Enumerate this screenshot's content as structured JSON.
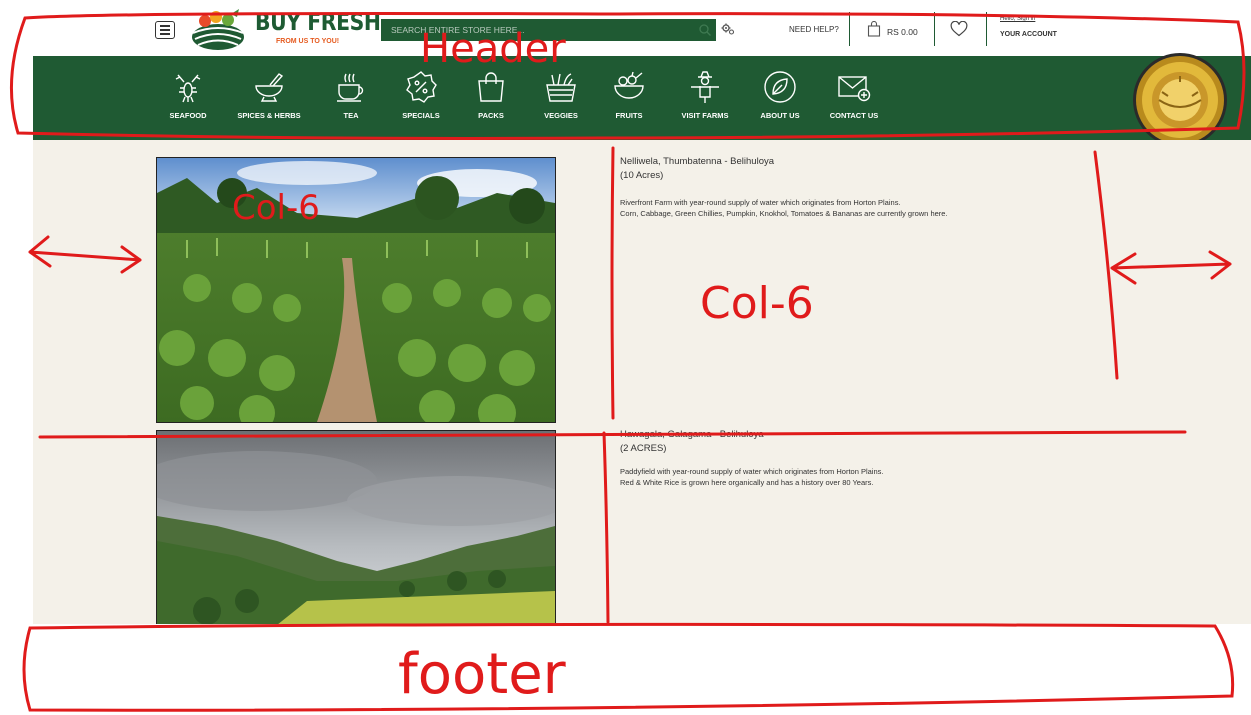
{
  "header": {
    "logo": {
      "brand": "BUY FRESH",
      "tagline": "FROM US TO YOU!"
    },
    "search": {
      "placeholder": "SEARCH ENTIRE STORE HERE..."
    },
    "help_label": "NEED HELP?",
    "cart": {
      "total": "RS 0.00"
    },
    "account": {
      "greeting": "Hello, Sign in",
      "label": "YOUR ACCOUNT"
    }
  },
  "nav": {
    "items": [
      {
        "label": "SEAFOOD",
        "icon": "lobster-icon"
      },
      {
        "label": "SPICES & HERBS",
        "icon": "mortar-pestle-icon"
      },
      {
        "label": "TEA",
        "icon": "tea-cup-icon"
      },
      {
        "label": "SPECIALS",
        "icon": "percent-badge-icon"
      },
      {
        "label": "PACKS",
        "icon": "shopping-bag-icon"
      },
      {
        "label": "VEGGIES",
        "icon": "vegetable-basket-icon"
      },
      {
        "label": "FRUITS",
        "icon": "fruit-bowl-icon"
      },
      {
        "label": "VISIT FARMS",
        "icon": "scarecrow-icon"
      },
      {
        "label": "ABOUT US",
        "icon": "leaf-circle-icon"
      },
      {
        "label": "CONTACT US",
        "icon": "envelope-plus-icon"
      }
    ],
    "award_badge": {
      "icon": "gold-award-seal-icon"
    }
  },
  "farms": [
    {
      "title": "Nelliwela, Thumbatenna - Belihuloya",
      "acres": "(10 Acres)",
      "desc_lines": [
        "Riverfront Farm with year-round supply of water which originates from Horton Plains.",
        "Corn, Cabbage, Green Chillies, Pumpkin, Knokhol, Tomatoes & Bananas are currently grown here."
      ]
    },
    {
      "title": "Hawagala, Galagama - Belihuloya",
      "acres": "(2 ACRES)",
      "desc_lines": [
        "Paddyfield with year-round supply of water which originates from Horton Plains.",
        "Red & White Rice is grown here organically and has a history over 80 Years."
      ]
    }
  ],
  "annotations": {
    "header": "Header",
    "col_left": "Col-6",
    "col_right": "Col-6",
    "footer": "footer",
    "color": "#e01b1b"
  },
  "colors": {
    "brand_green": "#1f5a33",
    "content_bg": "#f4f1e9",
    "accent_orange": "#e55a1f"
  }
}
